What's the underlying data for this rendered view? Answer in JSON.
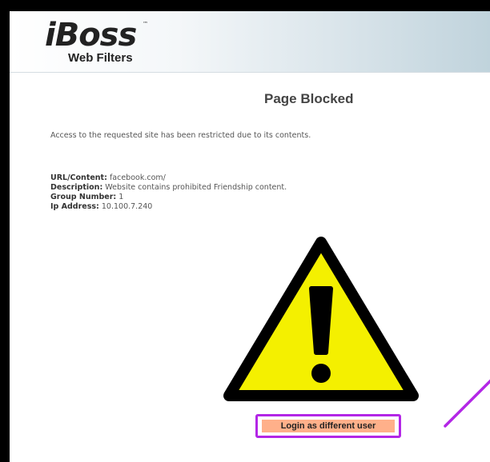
{
  "logo": {
    "brand": "iBoss",
    "tagline": "Web Filters",
    "trademark": "™"
  },
  "page": {
    "title": "Page Blocked",
    "message": "Access to the requested site has been restricted due to its contents."
  },
  "details": {
    "url_label": "URL/Content:",
    "url_value": "facebook.com/",
    "description_label": "Description:",
    "description_value": "Website contains prohibited Friendship content.",
    "group_label": "Group Number:",
    "group_value": "1",
    "ip_label": "Ip Address:",
    "ip_value": "10.100.7.240"
  },
  "warning_icon": "warning-triangle-icon",
  "login_button": {
    "label": "Login as different user"
  },
  "colors": {
    "highlight": "#b326e6",
    "button_fill": "#ffb08a",
    "warning_fill": "#f4f000",
    "header_gradient_end": "#c0d3dc"
  }
}
